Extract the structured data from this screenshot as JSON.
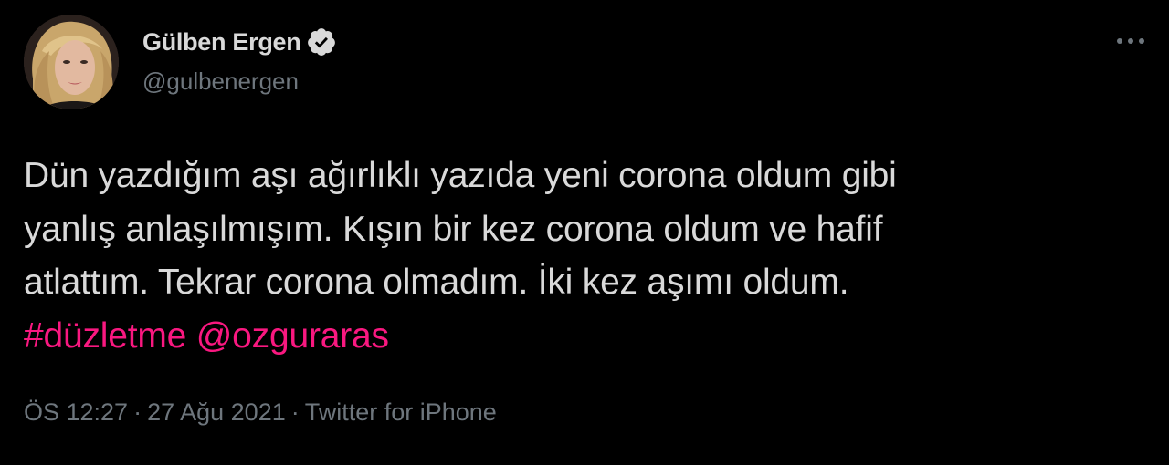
{
  "user": {
    "display_name": "Gülben Ergen",
    "handle": "@gulbenergen",
    "verified": true,
    "avatar_icon": "profile-photo"
  },
  "tweet": {
    "lines": [
      "Dün yazdığım aşı ağırlıklı yazıda yeni corona oldum gibi",
      "yanlış anlaşılmışım. Kışın bir kez corona oldum ve hafif",
      "atlattım. Tekrar corona olmadım. İki kez aşımı oldum."
    ],
    "hashtag": "#düzletme",
    "mention": "@ozguraras"
  },
  "meta": {
    "time": "ÖS 12:27",
    "date": "27 Ağu 2021",
    "source": "Twitter for iPhone",
    "separator": "·"
  },
  "colors": {
    "background": "#000000",
    "text": "#d9d9d9",
    "secondary": "#6e767d",
    "accent": "#f91880"
  },
  "icons": {
    "more": "more-horizontal-icon",
    "verified": "verified-badge-icon"
  }
}
